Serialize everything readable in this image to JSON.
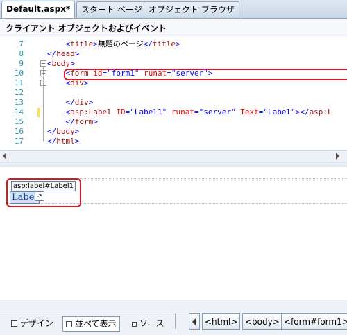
{
  "tabs": [
    {
      "label": "Default.aspx*",
      "active": true
    },
    {
      "label": "スタート ページ",
      "active": false
    },
    {
      "label": "オブジェクト ブラウザ",
      "active": false
    }
  ],
  "member_dropdown": "クライアント オブジェクトおよびイベント",
  "code_lines": [
    {
      "num": "7",
      "parts": [
        [
          "b",
          "    <"
        ],
        [
          "m",
          "title"
        ],
        [
          "b",
          ">"
        ],
        [
          "",
          "無題のページ"
        ],
        [
          "b",
          "</"
        ],
        [
          "m",
          "title"
        ],
        [
          "b",
          ">"
        ]
      ]
    },
    {
      "num": "8",
      "parts": [
        [
          "b",
          "</"
        ],
        [
          "m",
          "head"
        ],
        [
          "b",
          ">"
        ]
      ]
    },
    {
      "num": "9",
      "parts": [
        [
          "b",
          "<"
        ],
        [
          "m",
          "body"
        ],
        [
          "b",
          ">"
        ]
      ]
    },
    {
      "num": "10",
      "parts": [
        [
          "b",
          "    <"
        ],
        [
          "m",
          "form"
        ],
        [
          "",
          " "
        ],
        [
          "r",
          "id"
        ],
        [
          "b",
          "=\"form1\""
        ],
        [
          "",
          " "
        ],
        [
          "r",
          "runat"
        ],
        [
          "b",
          "=\"server\">"
        ]
      ]
    },
    {
      "num": "11",
      "parts": [
        [
          "b",
          "    <"
        ],
        [
          "m",
          "div"
        ],
        [
          "b",
          ">"
        ]
      ]
    },
    {
      "num": "12",
      "parts": [
        [
          "",
          ""
        ]
      ]
    },
    {
      "num": "13",
      "parts": [
        [
          "b",
          "    </"
        ],
        [
          "m",
          "div"
        ],
        [
          "b",
          ">"
        ]
      ]
    },
    {
      "num": "14",
      "parts": [
        [
          "b",
          "    <"
        ],
        [
          "m",
          "asp:Label"
        ],
        [
          "",
          " "
        ],
        [
          "r",
          "ID"
        ],
        [
          "b",
          "=\"Label1\""
        ],
        [
          "",
          " "
        ],
        [
          "r",
          "runat"
        ],
        [
          "b",
          "=\"server\""
        ],
        [
          "",
          " "
        ],
        [
          "r",
          "Text"
        ],
        [
          "b",
          "=\"Label\"></"
        ],
        [
          "m",
          "asp:L"
        ]
      ]
    },
    {
      "num": "15",
      "parts": [
        [
          "b",
          "    </"
        ],
        [
          "m",
          "form"
        ],
        [
          "b",
          ">"
        ]
      ]
    },
    {
      "num": "16",
      "parts": [
        [
          "b",
          "</"
        ],
        [
          "m",
          "body"
        ],
        [
          "b",
          ">"
        ]
      ]
    },
    {
      "num": "17",
      "parts": [
        [
          "b",
          "</"
        ],
        [
          "m",
          "html"
        ],
        [
          "b",
          ">"
        ]
      ]
    }
  ],
  "design": {
    "tag_chip": "asp:label#Label1",
    "label_text": "Label",
    "smart_tag": ">"
  },
  "view_buttons": {
    "design": "デザイン",
    "split": "並べて表示",
    "source": "ソース"
  },
  "tag_nav": [
    "<html>",
    "<body>",
    "<form#form1>"
  ]
}
